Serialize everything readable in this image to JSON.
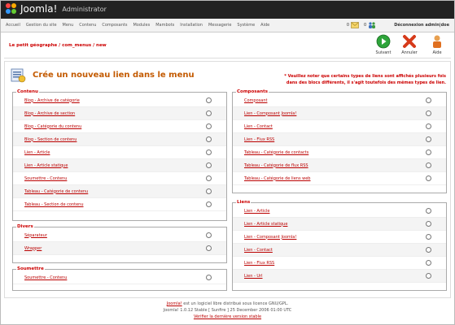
{
  "app": {
    "name": "Joomla!",
    "subtitle": "Administrator"
  },
  "menu": {
    "items": [
      "Accueil",
      "Gestion du site",
      "Menu",
      "Contenu",
      "Composants",
      "Modules",
      "Mambots",
      "Installation",
      "Messagerie",
      "Système",
      "Aide"
    ]
  },
  "status": {
    "messages_count": "0",
    "users_count": "0",
    "logout": "Déconnexion admin|doe"
  },
  "toolbar": {
    "title": "Le petit géographe / com_menus / new",
    "next": "Suivant",
    "cancel": "Annuler",
    "help": "Aide"
  },
  "page": {
    "heading": "Crée un nouveau lien dans le menu",
    "note": "* Veuillez noter que certains types de liens sont affichés plusieurs fois dans des blocs différents, il s'agit toutefois des mêmes types de lien."
  },
  "groups": {
    "contenu": {
      "title": "Contenu",
      "items": [
        "Blog - Archive de catégorie",
        "Blog - Archive de section",
        "Blog - Catégorie du contenu",
        "Blog - Section de contenu",
        "Lien - Article",
        "Lien - Article statique",
        "Soumettre - Contenu",
        "Tableau - Catégorie de contenu",
        "Tableau - Section de contenu"
      ]
    },
    "divers": {
      "title": "Divers",
      "items": [
        "Séparateur",
        "Wrapper"
      ]
    },
    "soumettre": {
      "title": "Soumettre",
      "items": [
        "Soumettre - Contenu"
      ]
    },
    "composants": {
      "title": "Composants",
      "items": [
        "Composant",
        "Lien - Composant Joomla!",
        "Lien - Contact",
        "Lien - Flux RSS",
        "Tableau - Catégorie de contacts",
        "Tableau - Catégorie de flux RSS",
        "Tableau - Catégorie de liens web"
      ]
    },
    "liens": {
      "title": "Liens",
      "items": [
        "Lien - Article",
        "Lien - Article statique",
        "Lien - Composant Joomla!",
        "Lien - Contact",
        "Lien - Flux RSS",
        "Lien - Url"
      ]
    }
  },
  "footer": {
    "line1_link": "Joomla!",
    "line1_text": " est un logiciel libre distribué sous licence GNU/GPL.",
    "line2": "Joomla! 1.0.12 Stable [ Sunfire ] 25 December 2006 01:00 UTC",
    "line3": "Vérifier la dernière version stable"
  },
  "colors": {
    "accent": "#cc0000",
    "heading": "#c35a00",
    "topbar": "#222222"
  }
}
